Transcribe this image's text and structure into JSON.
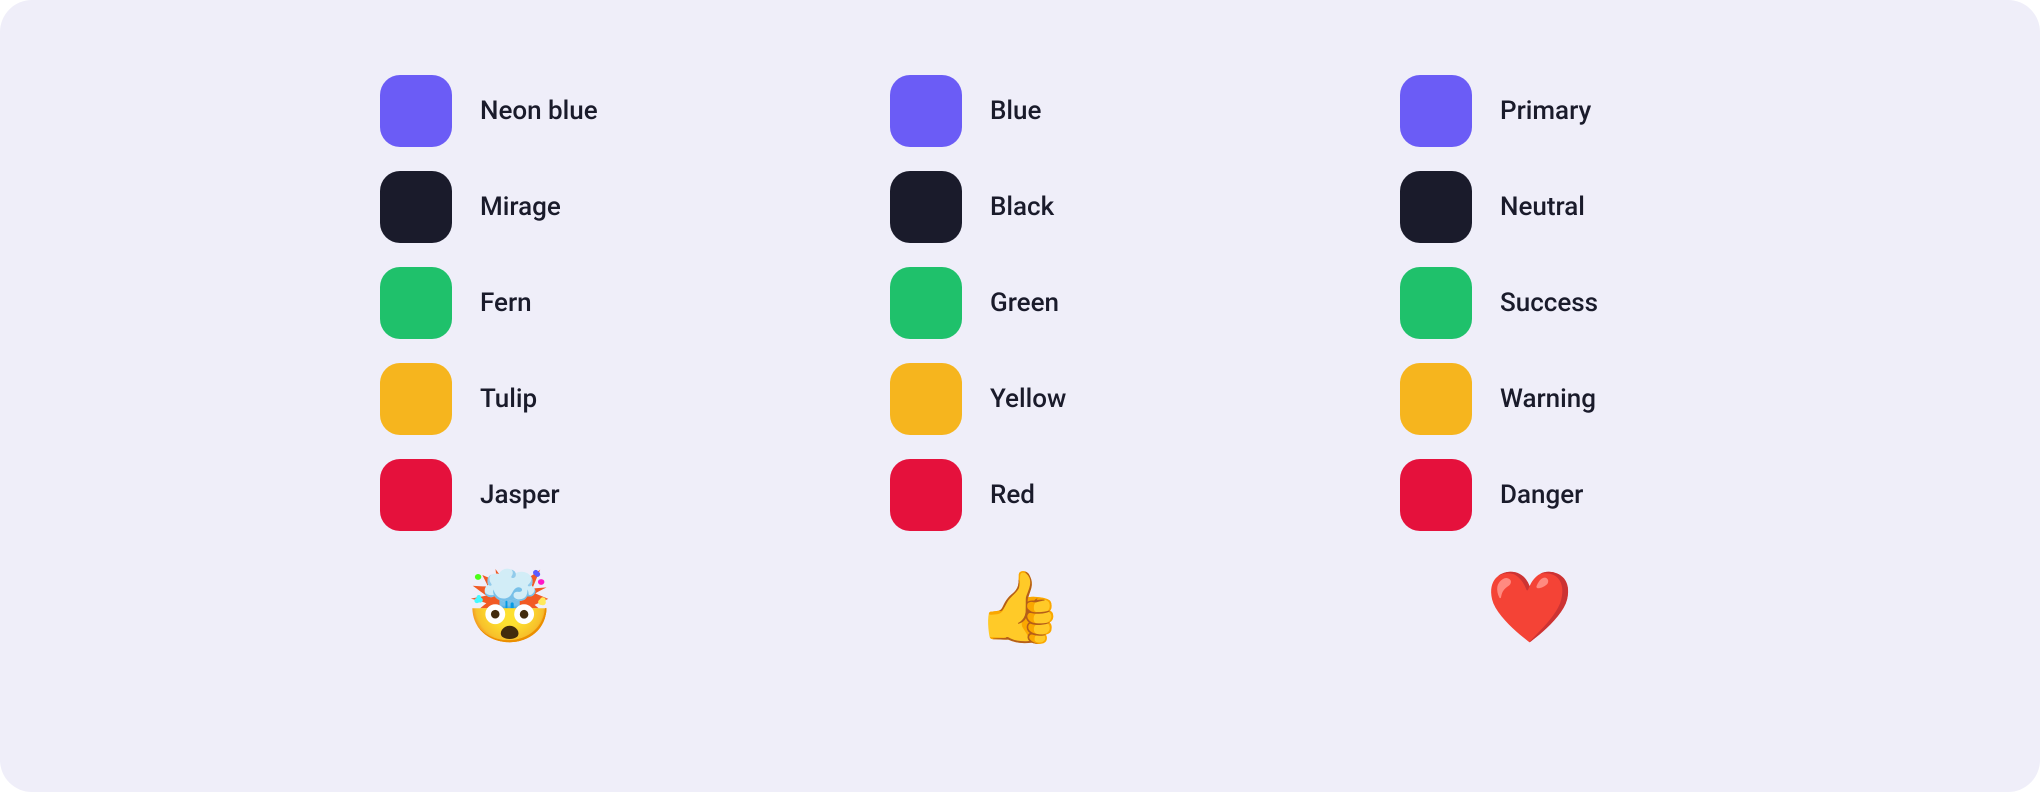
{
  "colors": {
    "blue": "#6B5CF6",
    "black": "#1A1B2B",
    "green": "#1FC16B",
    "yellow": "#F6B51E",
    "red": "#E5113C"
  },
  "columns": [
    {
      "emoji": "🤯",
      "items": [
        {
          "label": "Neon blue",
          "colorKey": "blue"
        },
        {
          "label": "Mirage",
          "colorKey": "black"
        },
        {
          "label": "Fern",
          "colorKey": "green"
        },
        {
          "label": "Tulip",
          "colorKey": "yellow"
        },
        {
          "label": "Jasper",
          "colorKey": "red"
        }
      ]
    },
    {
      "emoji": "👍",
      "items": [
        {
          "label": "Blue",
          "colorKey": "blue"
        },
        {
          "label": "Black",
          "colorKey": "black"
        },
        {
          "label": "Green",
          "colorKey": "green"
        },
        {
          "label": "Yellow",
          "colorKey": "yellow"
        },
        {
          "label": "Red",
          "colorKey": "red"
        }
      ]
    },
    {
      "emoji": "❤️",
      "items": [
        {
          "label": "Primary",
          "colorKey": "blue"
        },
        {
          "label": "Neutral",
          "colorKey": "black"
        },
        {
          "label": "Success",
          "colorKey": "green"
        },
        {
          "label": "Warning",
          "colorKey": "yellow"
        },
        {
          "label": "Danger",
          "colorKey": "red"
        }
      ]
    }
  ]
}
